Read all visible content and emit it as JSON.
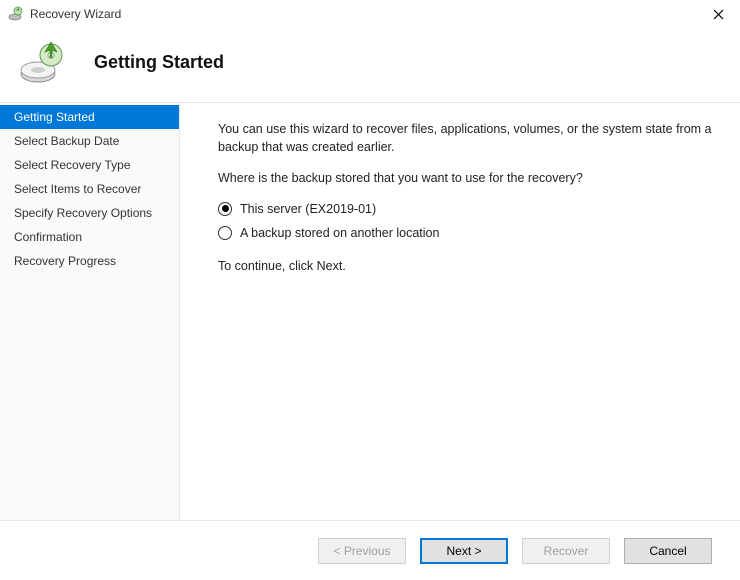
{
  "window": {
    "title": "Recovery Wizard"
  },
  "header": {
    "title": "Getting Started"
  },
  "sidebar": {
    "items": [
      {
        "label": "Getting Started",
        "active": true
      },
      {
        "label": "Select Backup Date",
        "active": false
      },
      {
        "label": "Select Recovery Type",
        "active": false
      },
      {
        "label": "Select Items to Recover",
        "active": false
      },
      {
        "label": "Specify Recovery Options",
        "active": false
      },
      {
        "label": "Confirmation",
        "active": false
      },
      {
        "label": "Recovery Progress",
        "active": false
      }
    ]
  },
  "main": {
    "intro": "You can use this wizard to recover files, applications, volumes, or the system state from a backup that was created earlier.",
    "question": "Where is the backup stored that you want to use for the recovery?",
    "options": {
      "this_server": "This server (EX2019-01)",
      "other_location": "A backup stored on another location"
    },
    "selected_option": "this_server",
    "continue_hint": "To continue, click Next."
  },
  "footer": {
    "previous": "< Previous",
    "next": "Next >",
    "recover": "Recover",
    "cancel": "Cancel"
  }
}
